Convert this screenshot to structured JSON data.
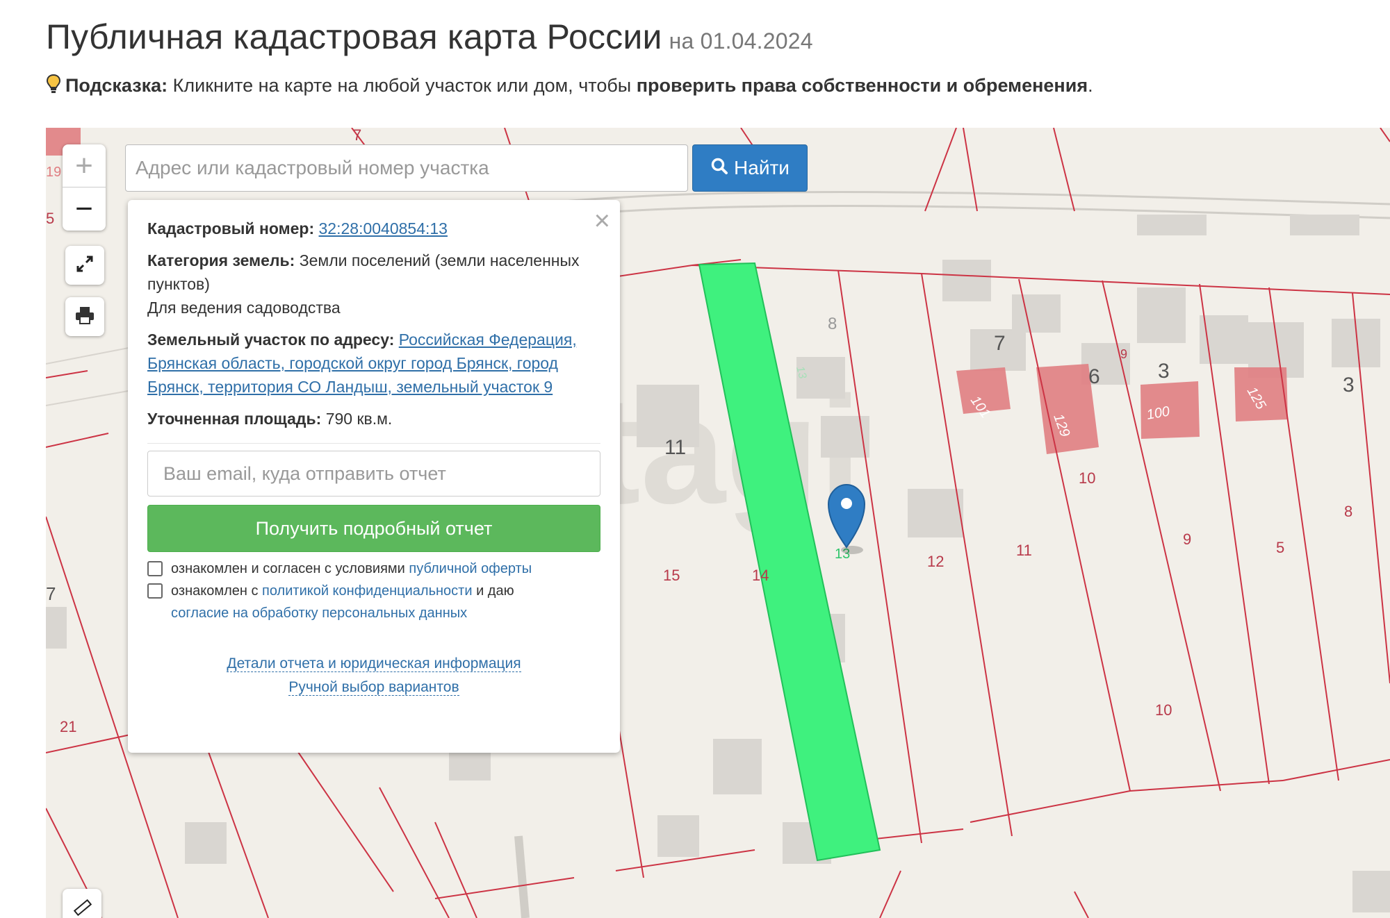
{
  "header": {
    "title": "Публичная кадастровая карта России",
    "date": "на 01.04.2024"
  },
  "hint": {
    "label": "Подсказка:",
    "text_before": " Кликните на карте на любой участок или дом, чтобы ",
    "text_bold": "проверить права собственности и обременения",
    "text_after": "."
  },
  "map": {
    "zoom_in": "+",
    "zoom_out": "−",
    "watermark": "etagi",
    "parcel_labels": [
      "7",
      "5",
      "3",
      "11",
      "12",
      "11",
      "15",
      "14",
      "9",
      "5",
      "8",
      "10",
      "21",
      "10",
      "9",
      "6",
      "7",
      "8",
      "3",
      "13",
      "7",
      "19"
    ],
    "house_labels": [
      "101",
      "129",
      "100",
      "125",
      "13"
    ],
    "colors": {
      "selected_parcel": "#3ff17e",
      "parcel_border": "#cc3344",
      "building_red": "#e07e82",
      "map_bg": "#f2efe9",
      "marker": "#2f7dc4"
    }
  },
  "search": {
    "placeholder": "Адрес или кадастровый номер участка",
    "button_label": "Найти"
  },
  "popup": {
    "close": "×",
    "cadastral_label": "Кадастровый номер:",
    "cadastral_value": "32:28:0040854:13",
    "category_label": "Категория земель:",
    "category_value": "Земли поселений (земли населенных пунктов)",
    "usage": "Для ведения садоводства",
    "address_label": "Земельный участок по адресу:",
    "address_value": "Российская Федерация, Брянская область, городской округ город Брянск, город Брянск, территория СО Ландыш, земельный участок 9",
    "area_label": "Уточненная площадь:",
    "area_value": "790 кв.м.",
    "email_placeholder": "Ваш email, куда отправить отчет",
    "report_button": "Получить подробный отчет",
    "consent1_text": "ознакомлен и согласен с условиями ",
    "consent1_link": "публичной оферты",
    "consent2_text": "ознакомлен с ",
    "consent2_link": "политикой конфиденциальности",
    "consent2_mid": " и даю ",
    "consent2_link2": "согласие на обработку персональных данных",
    "link_details": "Детали отчета и юридическая информация",
    "link_manual": "Ручной выбор вариантов"
  }
}
